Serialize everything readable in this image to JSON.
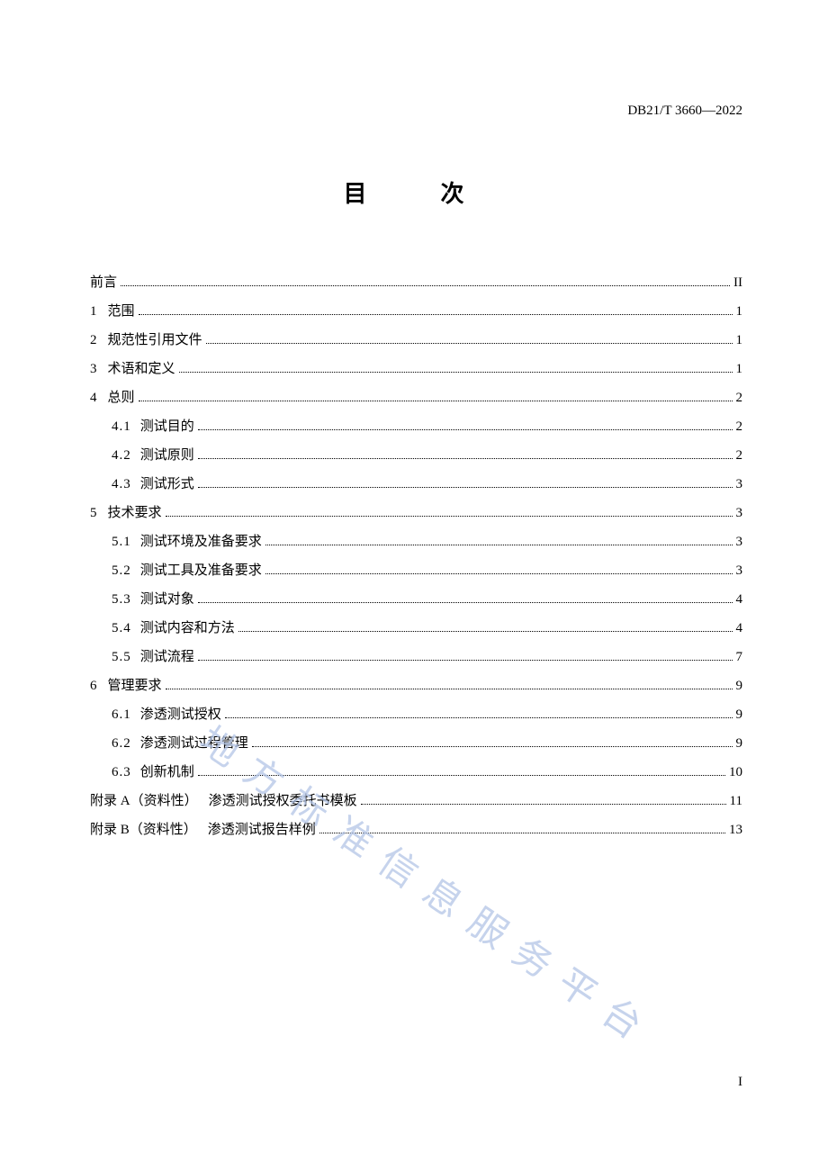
{
  "doc_code": "DB21/T 3660—2022",
  "title": "目　次",
  "watermark": "地方标准信息服务平台",
  "page_number": "I",
  "toc": [
    {
      "level": 1,
      "num": "",
      "label": "前言",
      "page": "II"
    },
    {
      "level": 1,
      "num": "1",
      "label": "范围",
      "page": "1"
    },
    {
      "level": 1,
      "num": "2",
      "label": "规范性引用文件",
      "page": "1"
    },
    {
      "level": 1,
      "num": "3",
      "label": "术语和定义",
      "page": "1"
    },
    {
      "level": 1,
      "num": "4",
      "label": "总则",
      "page": "2"
    },
    {
      "level": 2,
      "num": "4.1",
      "label": "测试目的",
      "page": "2"
    },
    {
      "level": 2,
      "num": "4.2",
      "label": "测试原则",
      "page": "2"
    },
    {
      "level": 2,
      "num": "4.3",
      "label": "测试形式",
      "page": "3"
    },
    {
      "level": 1,
      "num": "5",
      "label": "技术要求",
      "page": "3"
    },
    {
      "level": 2,
      "num": "5.1",
      "label": "测试环境及准备要求",
      "page": "3"
    },
    {
      "level": 2,
      "num": "5.2",
      "label": "测试工具及准备要求",
      "page": "3"
    },
    {
      "level": 2,
      "num": "5.3",
      "label": "测试对象",
      "page": "4"
    },
    {
      "level": 2,
      "num": "5.4",
      "label": "测试内容和方法",
      "page": "4"
    },
    {
      "level": 2,
      "num": "5.5",
      "label": "测试流程",
      "page": "7"
    },
    {
      "level": 1,
      "num": "6",
      "label": "管理要求",
      "page": "9"
    },
    {
      "level": 2,
      "num": "6.1",
      "label": "渗透测试授权",
      "page": "9"
    },
    {
      "level": 2,
      "num": "6.2",
      "label": "渗透测试过程管理",
      "page": "9"
    },
    {
      "level": 2,
      "num": "6.3",
      "label": "创新机制",
      "page": "10"
    },
    {
      "level": 1,
      "num": "附录 A（资料性）",
      "label": "渗透测试授权委托书模板",
      "page": "11"
    },
    {
      "level": 1,
      "num": "附录 B（资料性）",
      "label": "渗透测试报告样例",
      "page": "13"
    }
  ]
}
